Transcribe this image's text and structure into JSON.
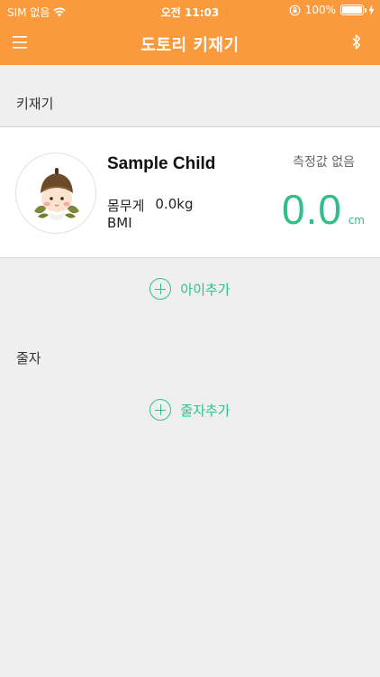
{
  "status_bar": {
    "carrier": "SIM 없음",
    "time": "오전 11:03",
    "battery": "100%"
  },
  "nav": {
    "title": "도토리 키재기",
    "menu_icon": "menu-icon",
    "bluetooth_icon": "bluetooth-icon"
  },
  "sections": {
    "height_meter": "키재기",
    "tape": "줄자"
  },
  "child": {
    "name": "Sample Child",
    "weight_label": "몸무게",
    "weight_value": "0.0kg",
    "bmi_label": "BMI",
    "measure_status": "측정값 없음",
    "height_value": "0.0",
    "height_unit": "cm"
  },
  "actions": {
    "add_child": "아이추가",
    "add_tape": "줄자추가"
  },
  "colors": {
    "accent_orange": "#fb9a3c",
    "accent_green": "#2fc08a",
    "background": "#efeff0"
  }
}
